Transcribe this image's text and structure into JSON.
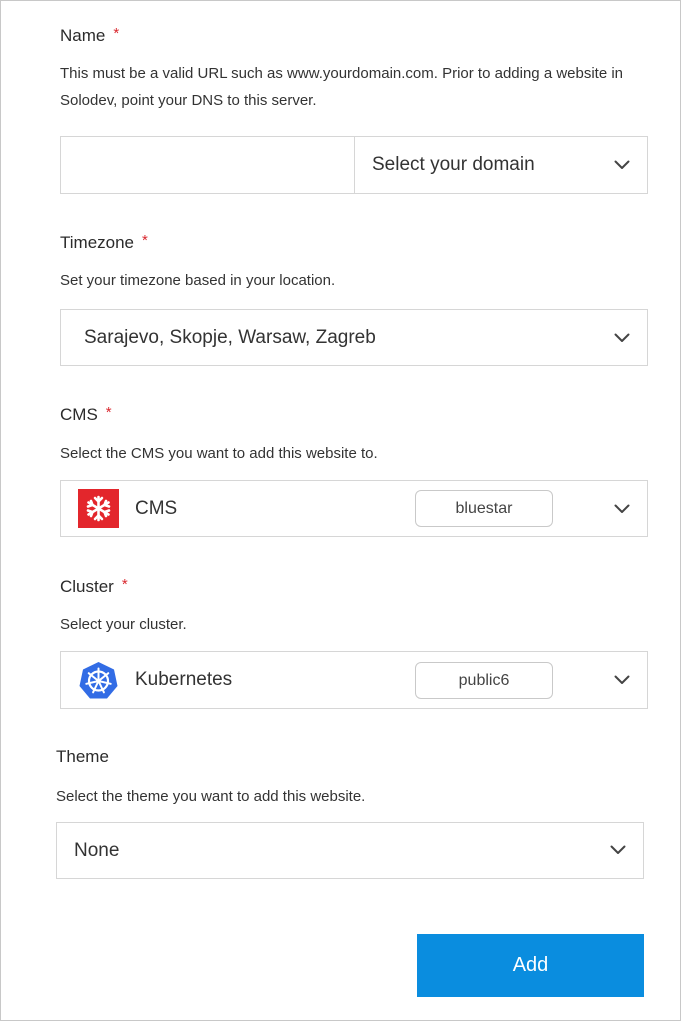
{
  "name": {
    "label": "Name",
    "required": "*",
    "help": "This must be a valid URL such as www.yourdomain.com. Prior to adding a website in Solodev, point your DNS to this server.",
    "input_value": "",
    "domain_select": "Select your domain",
    "domain_icon": "chevron-down-icon"
  },
  "timezone": {
    "label": "Timezone",
    "required": "*",
    "help": "Set your timezone based in your location.",
    "selected": "Sarajevo, Skopje, Warsaw, Zagreb",
    "icon": "chevron-down-icon"
  },
  "cms": {
    "label": "CMS",
    "required": "*",
    "help": "Select the CMS you want to add this website to.",
    "selected": "CMS",
    "tag": "bluestar",
    "logo_icon": "cms-logo-icon",
    "logo_color": "#e3262c",
    "icon": "chevron-down-icon"
  },
  "cluster": {
    "label": "Cluster",
    "required": "*",
    "help": "Select your cluster.",
    "selected": "Kubernetes",
    "tag": "public6",
    "logo_icon": "kubernetes-logo-icon",
    "logo_color": "#326ce5",
    "icon": "chevron-down-icon"
  },
  "theme": {
    "label": "Theme",
    "help": "Select the theme you want to add this website.",
    "selected": "None",
    "icon": "chevron-down-icon"
  },
  "actions": {
    "add_label": "Add",
    "accent": "#0a8ddf"
  }
}
